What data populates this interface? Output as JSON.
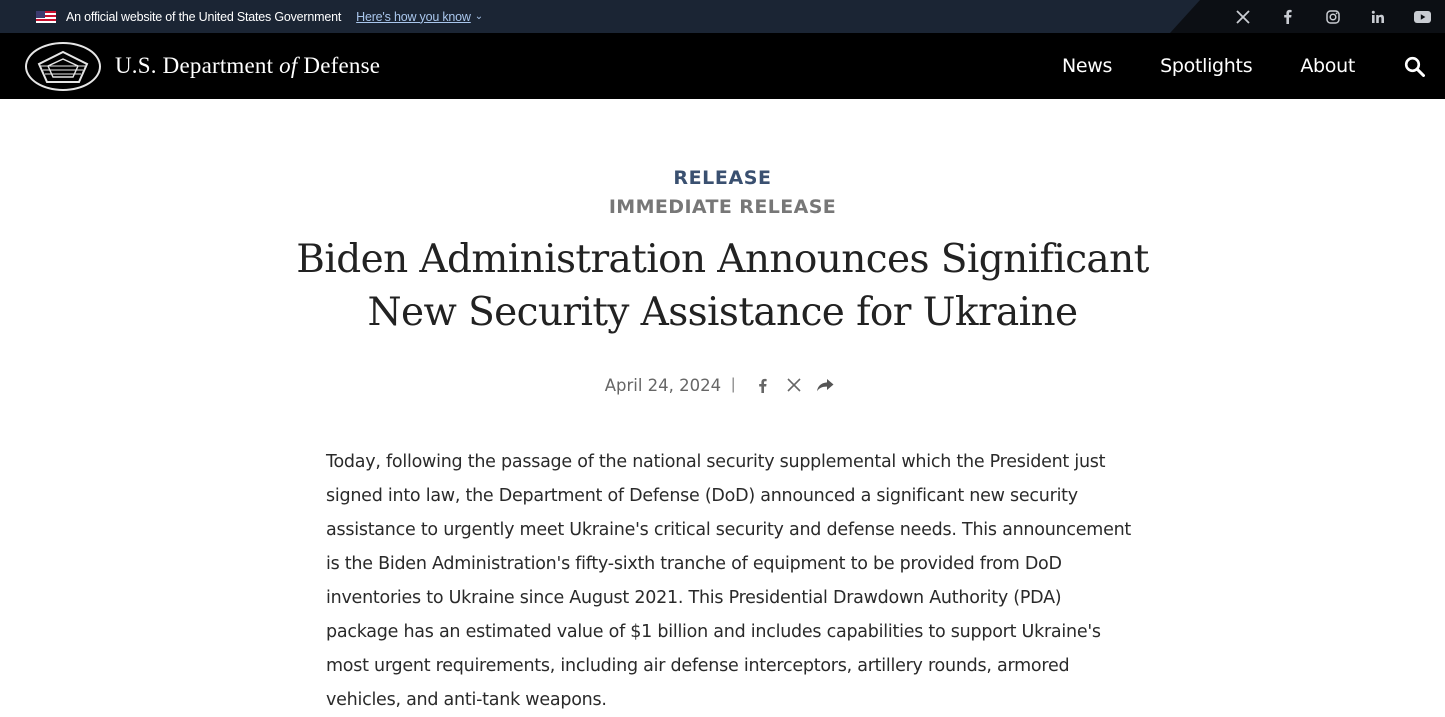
{
  "gov_banner": {
    "text": "An official website of the United States Government",
    "link": "Here's how you know",
    "chevron": "⌄"
  },
  "social": [
    {
      "icon": "x-icon"
    },
    {
      "icon": "facebook-icon"
    },
    {
      "icon": "instagram-icon"
    },
    {
      "icon": "linkedin-icon"
    },
    {
      "icon": "youtube-icon"
    }
  ],
  "header": {
    "site_prefix": "U.S. Department",
    "site_of": "of",
    "site_suffix": "Defense",
    "nav": [
      "News",
      "Spotlights",
      "About"
    ],
    "search_icon": "search-icon"
  },
  "article": {
    "kicker": "RELEASE",
    "subkicker": "IMMEDIATE RELEASE",
    "title": "Biden Administration Announces Significant New Security Assistance for Ukraine",
    "date": "April 24, 2024",
    "separator": "|",
    "share_icons": [
      "facebook-icon",
      "x-icon",
      "share-icon"
    ],
    "body": "Today, following the passage of the national security supplemental which the President just signed into law, the Department of Defense (DoD) announced a significant new security assistance to urgently meet Ukraine's critical security and defense needs. This announcement is the Biden Administration's fifty-sixth tranche of equipment to be provided from DoD inventories to Ukraine since August 2021. This Presidential Drawdown Authority (PDA) package has an estimated value of $1 billion and includes capabilities to support Ukraine's most urgent requirements, including air defense interceptors, artillery rounds, armored vehicles, and anti-tank weapons."
  }
}
